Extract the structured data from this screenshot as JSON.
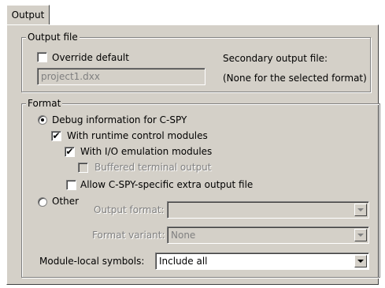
{
  "tab": {
    "label": "Output"
  },
  "output_file": {
    "legend": "Output file",
    "override_default_label": "Override default",
    "override_default_checked": false,
    "filename_value": "project1.dxx",
    "secondary_label": "Secondary output file:",
    "secondary_value": "(None for the selected format)"
  },
  "format": {
    "legend": "Format",
    "debug_info_label": "Debug information for C-SPY",
    "runtime_control_label": "With runtime control modules",
    "io_emulation_label": "With I/O emulation modules",
    "buffered_terminal_label": "Buffered terminal output",
    "allow_extra_output_label": "Allow C-SPY-specific extra output file",
    "other_label": "Other",
    "output_format_label": "Output format:",
    "output_format_value": "",
    "format_variant_label": "Format variant:",
    "format_variant_value": "None"
  },
  "module_local": {
    "label": "Module-local symbols:",
    "value": "Include all"
  },
  "icons": {
    "check": "✔",
    "dropdown": "chevron-down-icon"
  }
}
